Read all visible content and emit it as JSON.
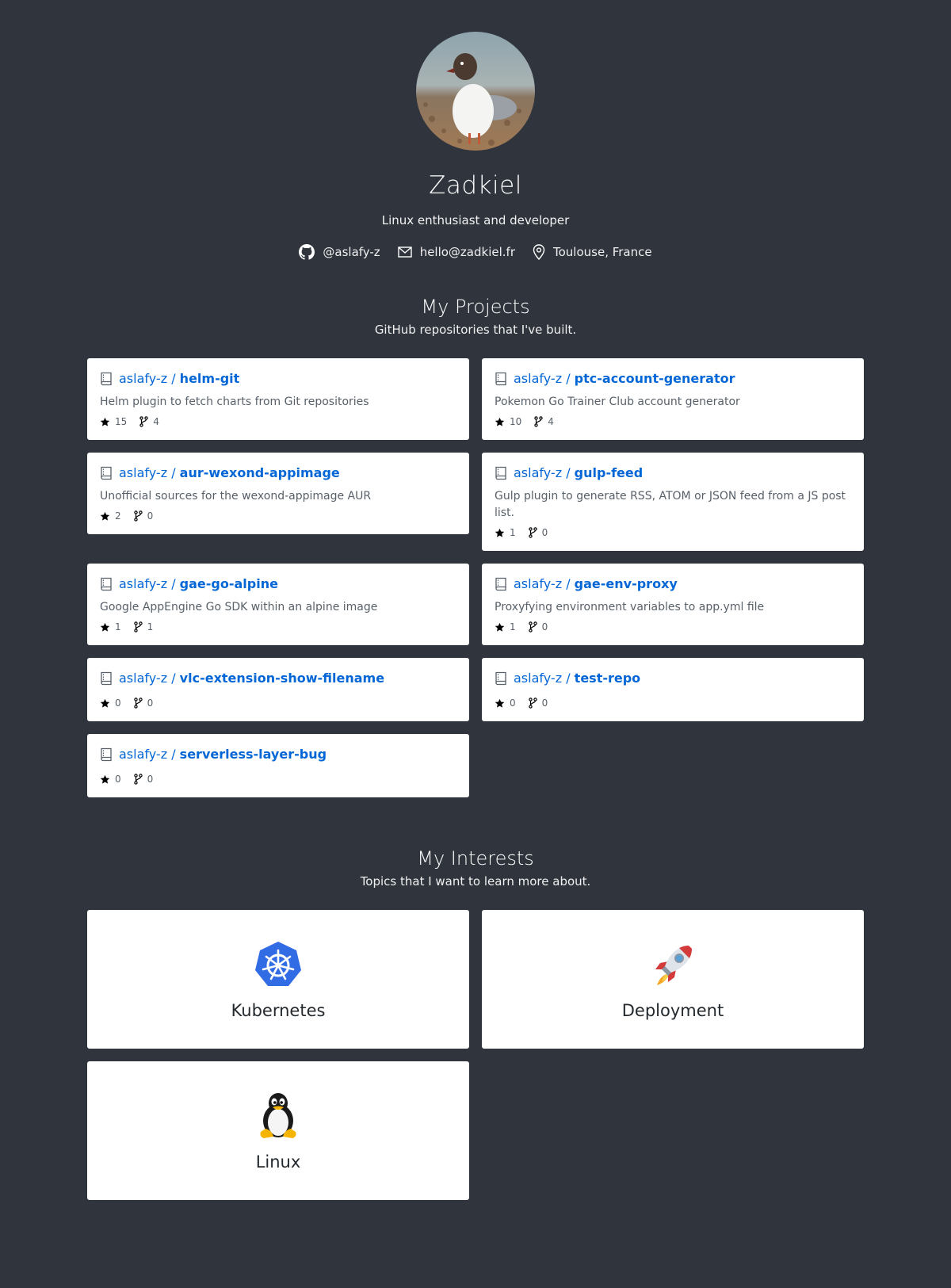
{
  "profile": {
    "name": "Zadkiel",
    "bio": "Linux enthusiast and developer",
    "github": "@aslafy-z",
    "email": "hello@zadkiel.fr",
    "location": "Toulouse, France"
  },
  "projects": {
    "title": "My Projects",
    "subtitle": "GitHub repositories that I've built.",
    "repos": [
      {
        "owner": "aslafy-z /",
        "name": "helm-git",
        "description": "Helm plugin to fetch charts from Git repositories",
        "stars": "15",
        "forks": "4"
      },
      {
        "owner": "aslafy-z /",
        "name": "ptc-account-generator",
        "description": "Pokemon Go Trainer Club account generator",
        "stars": "10",
        "forks": "4"
      },
      {
        "owner": "aslafy-z /",
        "name": "aur-wexond-appimage",
        "description": "Unofficial sources for the wexond-appimage AUR",
        "stars": "2",
        "forks": "0"
      },
      {
        "owner": "aslafy-z /",
        "name": "gulp-feed",
        "description": "Gulp plugin to generate RSS, ATOM or JSON feed from a JS post list.",
        "stars": "1",
        "forks": "0"
      },
      {
        "owner": "aslafy-z /",
        "name": "gae-go-alpine",
        "description": "Google AppEngine Go SDK within an alpine image",
        "stars": "1",
        "forks": "1"
      },
      {
        "owner": "aslafy-z /",
        "name": "gae-env-proxy",
        "description": "Proxyfying environment variables to app.yml file",
        "stars": "1",
        "forks": "0"
      },
      {
        "owner": "aslafy-z /",
        "name": "vlc-extension-show-filename",
        "description": "",
        "stars": "0",
        "forks": "0"
      },
      {
        "owner": "aslafy-z /",
        "name": "test-repo",
        "description": "",
        "stars": "0",
        "forks": "0"
      },
      {
        "owner": "aslafy-z /",
        "name": "serverless-layer-bug",
        "description": "",
        "stars": "0",
        "forks": "0"
      }
    ]
  },
  "interests": {
    "title": "My Interests",
    "subtitle": "Topics that I want to learn more about.",
    "items": [
      {
        "label": "Kubernetes",
        "icon": "kubernetes-icon"
      },
      {
        "label": "Deployment",
        "icon": "rocket-icon"
      },
      {
        "label": "Linux",
        "icon": "tux-penguin-icon"
      }
    ]
  },
  "colors": {
    "background": "#2f343d",
    "link": "#0366d6",
    "card": "#ffffff",
    "kubernetes": "#326ce5"
  }
}
